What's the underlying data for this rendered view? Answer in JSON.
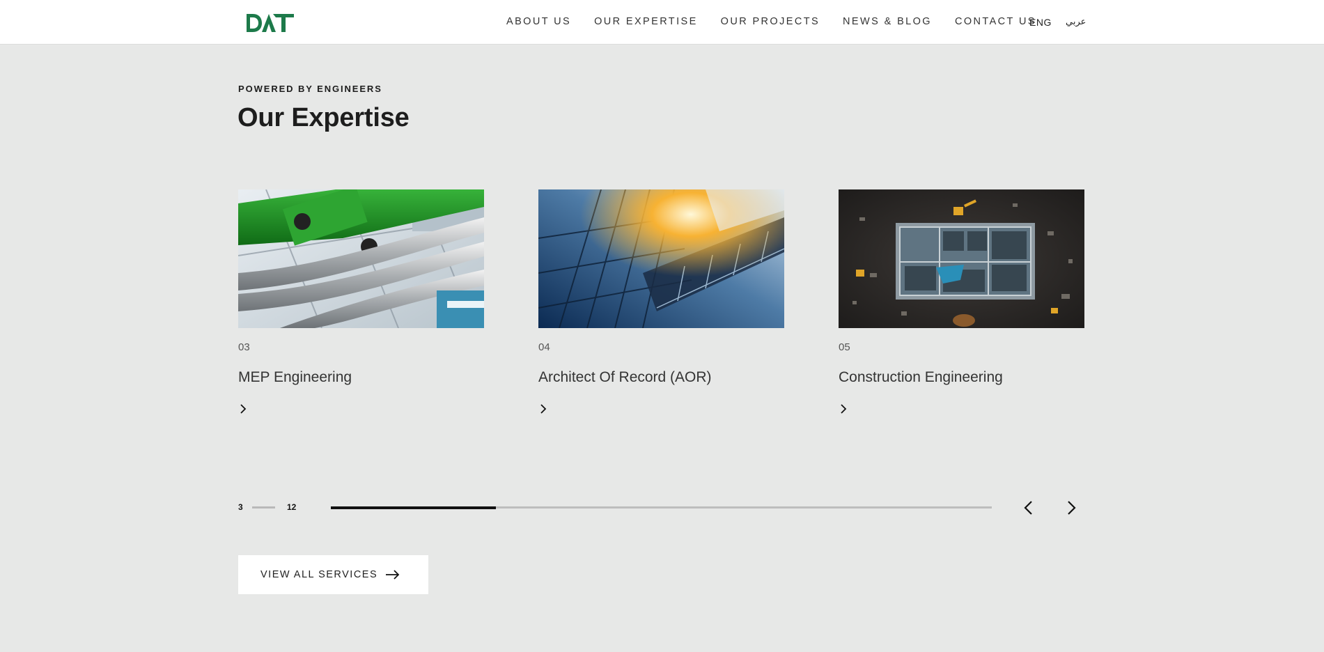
{
  "header": {
    "logo_text": "DAT",
    "nav": [
      {
        "label": "ABOUT US"
      },
      {
        "label": "OUR EXPERTISE"
      },
      {
        "label": "OUR PROJECTS"
      },
      {
        "label": "NEWS & BLOG"
      },
      {
        "label": "CONTACT US"
      }
    ],
    "lang_en": "ENG",
    "lang_ar": "عربي"
  },
  "section": {
    "eyebrow": "POWERED BY ENGINEERS",
    "title": "Our Expertise"
  },
  "cards": [
    {
      "number": "03",
      "title": "MEP Engineering",
      "image": "mep-engineering-pipes-photo"
    },
    {
      "number": "04",
      "title": "Architect Of Record (AOR)",
      "image": "glass-building-sunlight-photo"
    },
    {
      "number": "05",
      "title": "Construction Engineering",
      "image": "construction-site-aerial-photo"
    }
  ],
  "slider": {
    "current": "3",
    "total": "12",
    "progress_fraction": 0.25,
    "prev_icon": "chevron-left-icon",
    "next_icon": "chevron-right-icon"
  },
  "cta": {
    "label": "VIEW ALL SERVICES",
    "icon": "arrow-right-icon"
  },
  "colors": {
    "brand_green": "#1d7a4a",
    "page_bg": "#e7e8e7",
    "header_bg": "#ffffff",
    "text_dark": "#1d1d1d"
  }
}
